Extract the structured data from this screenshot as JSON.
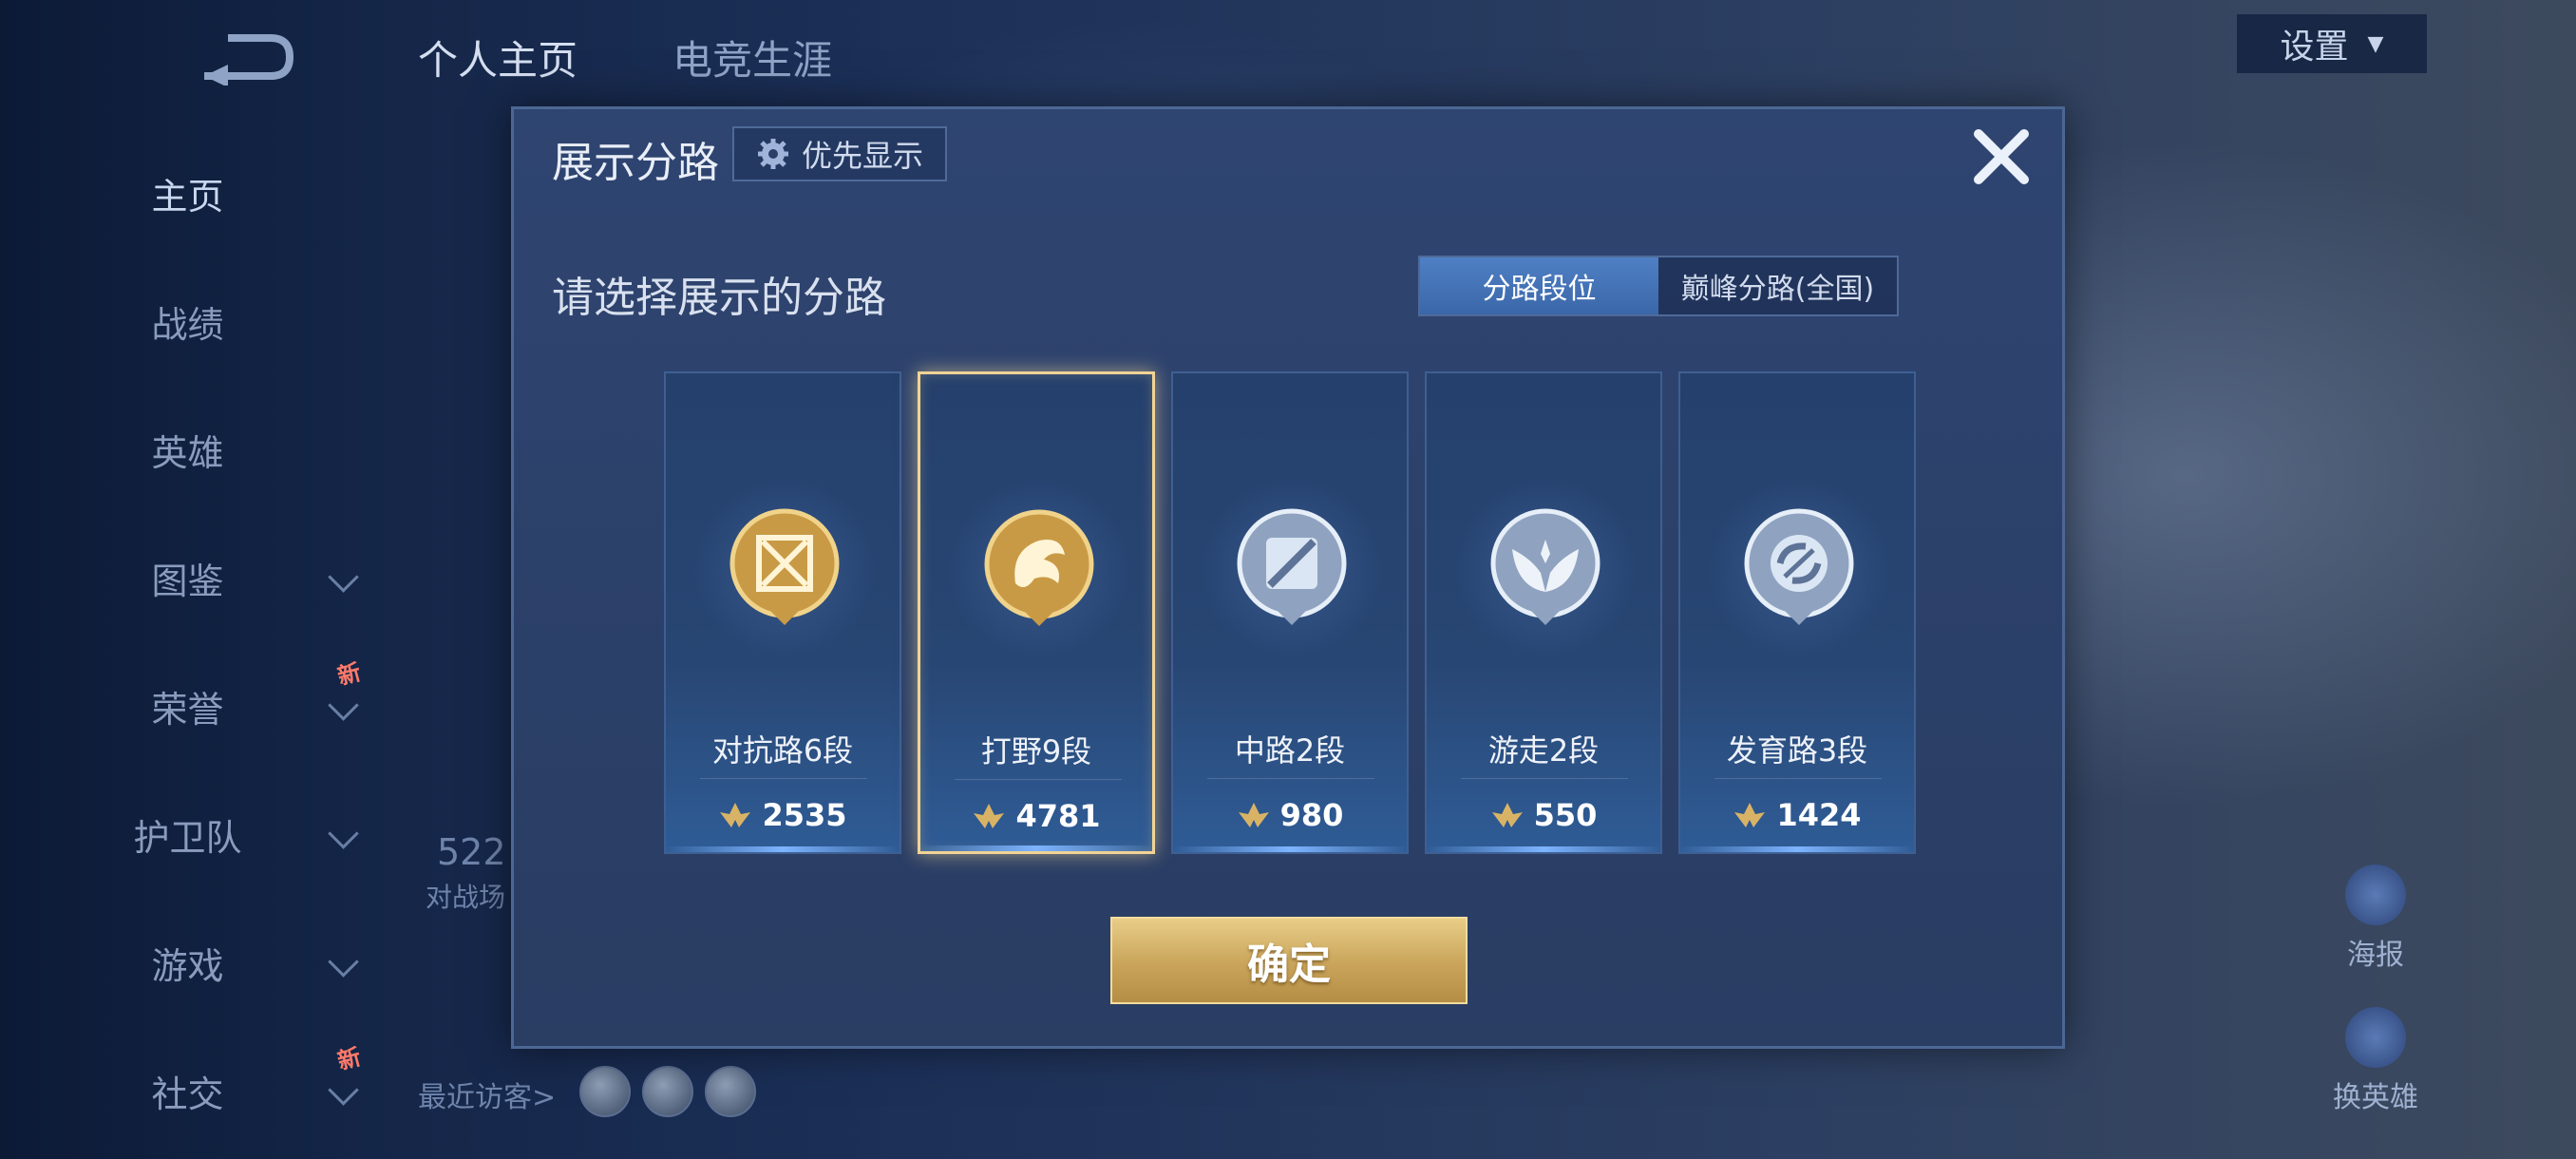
{
  "nav": {
    "items": [
      {
        "label": "主页",
        "chevron": false,
        "badge": ""
      },
      {
        "label": "战绩",
        "chevron": false,
        "badge": ""
      },
      {
        "label": "英雄",
        "chevron": false,
        "badge": ""
      },
      {
        "label": "图鉴",
        "chevron": true,
        "badge": ""
      },
      {
        "label": "荣誉",
        "chevron": true,
        "badge": "新"
      },
      {
        "label": "护卫队",
        "chevron": true,
        "badge": ""
      },
      {
        "label": "游戏",
        "chevron": true,
        "badge": ""
      },
      {
        "label": "社交",
        "chevron": true,
        "badge": "新"
      }
    ]
  },
  "top_tabs": [
    "个人主页",
    "电竞生涯"
  ],
  "settings_label": "设置",
  "visitors_label": "最近访客>",
  "bg_stat": {
    "value": "522",
    "label": "对战场"
  },
  "right_controls": {
    "poster": "海报",
    "change_hero": "换英雄"
  },
  "modal": {
    "title": "展示分路",
    "priority_label": "优先显示",
    "subtitle": "请选择展示的分路",
    "toggle": [
      "分路段位",
      "巅峰分路(全国)"
    ],
    "confirm_label": "确定",
    "cards": [
      {
        "label": "对抗路6段",
        "score": "2535",
        "tier": "gold",
        "icon": "sword-icon"
      },
      {
        "label": "打野9段",
        "score": "4781",
        "tier": "gold",
        "icon": "dragon-icon"
      },
      {
        "label": "中路2段",
        "score": "980",
        "tier": "silver",
        "icon": "slash-icon"
      },
      {
        "label": "游走2段",
        "score": "550",
        "tier": "silver",
        "icon": "wings-icon"
      },
      {
        "label": "发育路3段",
        "score": "1424",
        "tier": "silver",
        "icon": "target-icon"
      }
    ]
  },
  "colors": {
    "gold": "#e0b55a",
    "silver": "#c9d6e8",
    "accent": "#4f7fc4"
  }
}
